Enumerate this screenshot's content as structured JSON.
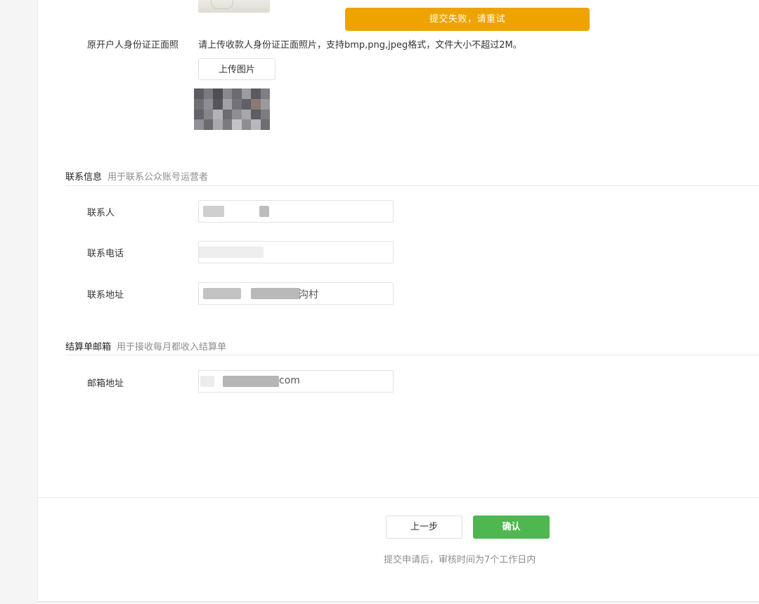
{
  "toast": {
    "message": "提交失败，请重试"
  },
  "id_photo_field": {
    "label": "原开户人身份证正面照",
    "hint": "请上传收款人身份证正面照片，支持bmp,png,jpeg格式，文件大小不超过2M。",
    "upload_label": "上传图片"
  },
  "contact_section": {
    "title": "联系信息",
    "desc": "用于联系公众账号运营者",
    "fields": {
      "contact_person_label": "联系人",
      "contact_phone_label": "联系电话",
      "contact_address_label": "联系地址",
      "contact_address_suffix": "沟村"
    }
  },
  "billing_section": {
    "title": "结算单邮箱",
    "desc": "用于接收每月都收入结算单",
    "fields": {
      "email_label": "邮箱地址",
      "email_suffix": "com"
    }
  },
  "footer": {
    "prev_label": "上一步",
    "confirm_label": "确认",
    "note": "提交申请后，审核时间为7个工作日内"
  },
  "colors": {
    "toast_bg": "#eea301",
    "confirm_bg": "#4eb74f",
    "muted_text": "#8d8d8d"
  }
}
